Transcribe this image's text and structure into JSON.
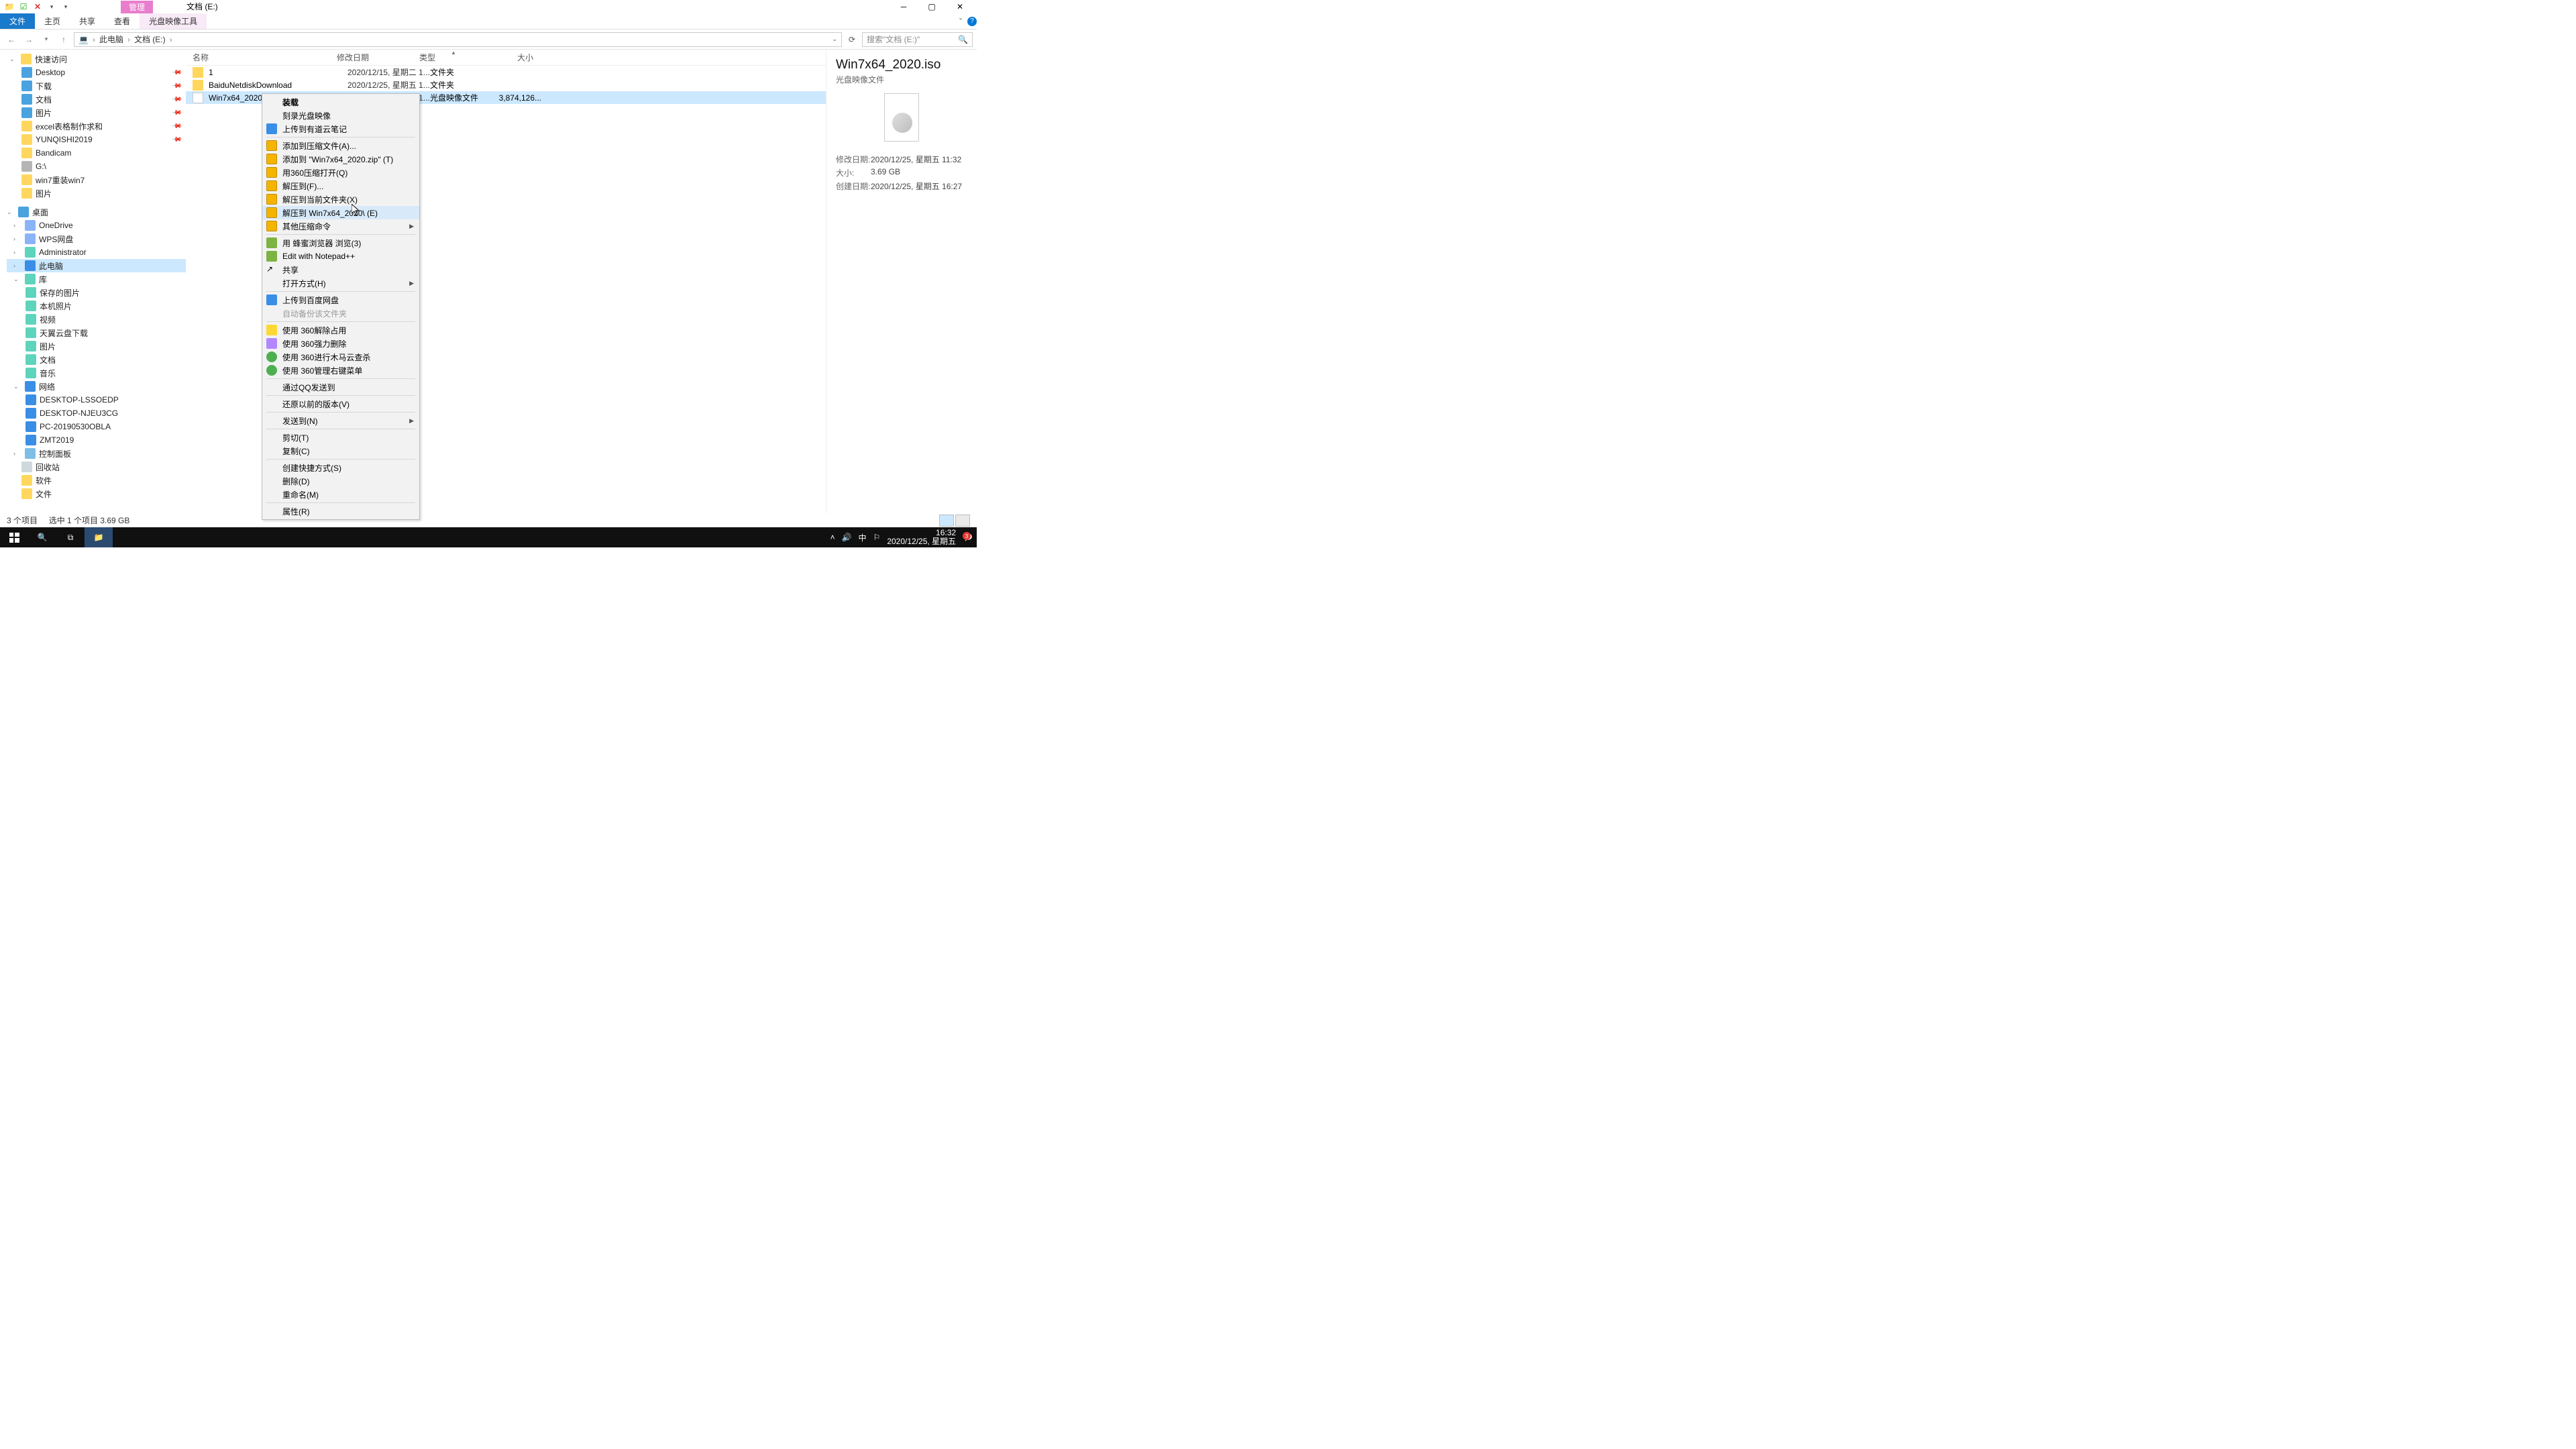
{
  "window": {
    "mgmt": "管理",
    "location_title": "文档 (E:)"
  },
  "ribbon": {
    "file": "文件",
    "home": "主页",
    "share": "共享",
    "view": "查看",
    "disc_tool": "光盘映像工具"
  },
  "addr": {
    "this_pc": "此电脑",
    "drive": "文档 (E:)"
  },
  "search": {
    "placeholder": "搜索\"文档 (E:)\""
  },
  "tree": {
    "quick": "快速访问",
    "desktop": "Desktop",
    "downloads": "下载",
    "documents": "文档",
    "pictures": "图片",
    "excel": "excel表格制作求和",
    "yunqishi": "YUNQISHI2019",
    "bandicam": "Bandicam",
    "g_drive": "G:\\",
    "win7reinstall": "win7重装win7",
    "pictures2": "图片",
    "desktop_group": "桌面",
    "onedrive": "OneDrive",
    "wps": "WPS网盘",
    "admin": "Administrator",
    "thispc": "此电脑",
    "libraries": "库",
    "saved_pics": "保存的图片",
    "camera_roll": "本机照片",
    "videos": "视频",
    "tianyi": "天翼云盘下载",
    "pics_lib": "图片",
    "docs_lib": "文档",
    "music": "音乐",
    "network": "网络",
    "net1": "DESKTOP-LSSOEDP",
    "net2": "DESKTOP-NJEU3CG",
    "net3": "PC-20190530OBLA",
    "net4": "ZMT2019",
    "ctrlpanel": "控制面板",
    "recycle": "回收站",
    "soft": "软件",
    "files": "文件"
  },
  "columns": {
    "name": "名称",
    "date": "修改日期",
    "type": "类型",
    "size": "大小"
  },
  "rows": [
    {
      "name": "1",
      "date": "2020/12/15, 星期二 1...",
      "type": "文件夹",
      "size": ""
    },
    {
      "name": "BaiduNetdiskDownload",
      "date": "2020/12/25, 星期五 1...",
      "type": "文件夹",
      "size": ""
    },
    {
      "name": "Win7x64_2020.iso",
      "date": "2020/12/25, 星期五 1...",
      "type": "光盘映像文件",
      "size": "3,874,126..."
    }
  ],
  "details": {
    "title": "Win7x64_2020.iso",
    "subtitle": "光盘映像文件",
    "mod_k": "修改日期:",
    "mod_v": "2020/12/25, 星期五 11:32",
    "size_k": "大小:",
    "size_v": "3.69 GB",
    "create_k": "创建日期:",
    "create_v": "2020/12/25, 星期五 16:27"
  },
  "ctx": [
    {
      "label": "装载",
      "ico": "blank",
      "bold": true
    },
    {
      "label": "刻录光盘映像",
      "ico": "blank"
    },
    {
      "label": "上传到有道云笔记",
      "ico": "blue"
    },
    {
      "sep": true
    },
    {
      "label": "添加到压缩文件(A)...",
      "ico": "zip"
    },
    {
      "label": "添加到 \"Win7x64_2020.zip\" (T)",
      "ico": "zip"
    },
    {
      "label": "用360压缩打开(Q)",
      "ico": "zip"
    },
    {
      "label": "解压到(F)...",
      "ico": "zip"
    },
    {
      "label": "解压到当前文件夹(X)",
      "ico": "zip"
    },
    {
      "label": "解压到 Win7x64_2020\\ (E)",
      "ico": "zip",
      "hov": true
    },
    {
      "label": "其他压缩命令",
      "ico": "zip",
      "sub": true
    },
    {
      "sep": true
    },
    {
      "label": "用 蜂蜜浏览器 浏览(3)",
      "ico": "green"
    },
    {
      "label": "Edit with Notepad++",
      "ico": "green"
    },
    {
      "label": "共享",
      "ico": "share"
    },
    {
      "label": "打开方式(H)",
      "ico": "blank",
      "sub": true
    },
    {
      "sep": true
    },
    {
      "label": "上传到百度网盘",
      "ico": "blue"
    },
    {
      "label": "自动备份该文件夹",
      "ico": "blank",
      "dis": true
    },
    {
      "sep": true
    },
    {
      "label": "使用 360解除占用",
      "ico": "yellow"
    },
    {
      "label": "使用 360强力删除",
      "ico": "purple"
    },
    {
      "label": "使用 360进行木马云查杀",
      "ico": "g360"
    },
    {
      "label": "使用 360管理右键菜单",
      "ico": "g360"
    },
    {
      "sep": true
    },
    {
      "label": "通过QQ发送到",
      "ico": "blank"
    },
    {
      "sep": true
    },
    {
      "label": "还原以前的版本(V)",
      "ico": "blank"
    },
    {
      "sep": true
    },
    {
      "label": "发送到(N)",
      "ico": "blank",
      "sub": true
    },
    {
      "sep": true
    },
    {
      "label": "剪切(T)",
      "ico": "blank"
    },
    {
      "label": "复制(C)",
      "ico": "blank"
    },
    {
      "sep": true
    },
    {
      "label": "创建快捷方式(S)",
      "ico": "blank"
    },
    {
      "label": "删除(D)",
      "ico": "blank"
    },
    {
      "label": "重命名(M)",
      "ico": "blank"
    },
    {
      "sep": true
    },
    {
      "label": "属性(R)",
      "ico": "blank"
    }
  ],
  "status": {
    "items": "3 个项目",
    "selected": "选中 1 个项目  3.69 GB"
  },
  "taskbar": {
    "time": "16:32",
    "date": "2020/12/25, 星期五",
    "ime": "中",
    "badge": "3"
  }
}
